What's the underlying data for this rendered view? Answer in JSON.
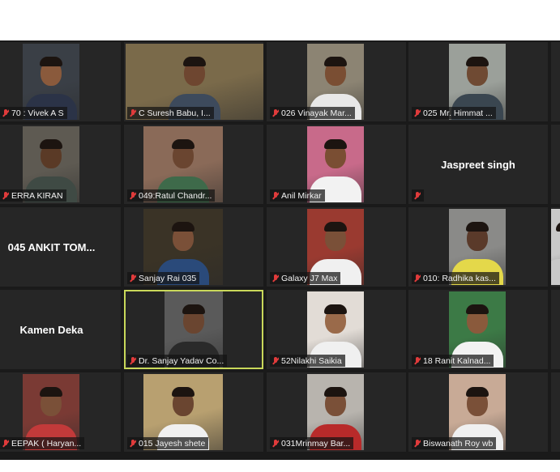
{
  "participants": [
    {
      "label": "70 : Vivek A S",
      "muted": true,
      "video": true,
      "bg": "#3a3f46",
      "skin": "#8a5a3c",
      "shirt": "#2b3347"
    },
    {
      "label": "C Suresh Babu, I...",
      "muted": true,
      "video": true,
      "bg": "#7a6a4a",
      "skin": "#6e4630",
      "shirt": "#3d4a5c"
    },
    {
      "label": "026 Vinayak Mar...",
      "muted": true,
      "video": true,
      "bg": "#8c8473",
      "skin": "#7a4e33",
      "shirt": "#e8e8e8"
    },
    {
      "label": "025 Mr. Himmat ...",
      "muted": true,
      "video": true,
      "bg": "#9ba09a",
      "skin": "#6f4a33",
      "shirt": "#3a4650"
    },
    {
      "label": "",
      "muted": true,
      "video": false,
      "name": ""
    },
    {
      "label": "ERRA KIRAN",
      "muted": true,
      "video": true,
      "bg": "#5e5a52",
      "skin": "#5a3a26",
      "shirt": "#3f4a44"
    },
    {
      "label": "049:Ratul Chandr...",
      "muted": true,
      "video": true,
      "bg": "#8a6a58",
      "skin": "#6a4530",
      "shirt": "#3e6a4a"
    },
    {
      "label": "Anil Mirkar",
      "muted": true,
      "video": true,
      "bg": "#c86a8a",
      "skin": "#7a4e33",
      "shirt": "#f2f2f2"
    },
    {
      "label": "",
      "muted": true,
      "video": false,
      "name": "Jaspreet singh"
    },
    {
      "label": "",
      "muted": true,
      "video": false,
      "name": ""
    },
    {
      "label": "",
      "muted": false,
      "video": false,
      "name": "045 ANKIT TOM..."
    },
    {
      "label": "Sanjay Rai 035",
      "muted": true,
      "video": true,
      "bg": "#3a3326",
      "skin": "#7a5038",
      "shirt": "#2a4a7a"
    },
    {
      "label": "Galaxy J7 Max",
      "muted": true,
      "video": true,
      "bg": "#9a3a30",
      "skin": "#7a5038",
      "shirt": "#f0f0f0"
    },
    {
      "label": "010: Radhika kas...",
      "muted": true,
      "video": true,
      "bg": "#8a8a88",
      "skin": "#5a3a2a",
      "shirt": "#e4d84a"
    },
    {
      "label": "",
      "muted": false,
      "video": true,
      "bg": "#c8c8c8",
      "skin": "#c8c8c8",
      "shirt": "#c8c8c8"
    },
    {
      "label": "",
      "muted": false,
      "video": false,
      "name": "Kamen Deka"
    },
    {
      "label": "Dr. Sanjay Yadav Co...",
      "muted": true,
      "video": true,
      "bg": "#5a5a5a",
      "skin": "#6a4530",
      "shirt": "#2a2a2a",
      "active": true
    },
    {
      "label": "52Nilakhi Saikia",
      "muted": true,
      "video": true,
      "bg": "#e2dcd6",
      "skin": "#9a6a4a",
      "shirt": "#f0f0f0"
    },
    {
      "label": "18 Ranit Kalnad...",
      "muted": true,
      "video": true,
      "bg": "#3c7a46",
      "skin": "#8a5a3c",
      "shirt": "#f2f2f2"
    },
    {
      "label": "",
      "muted": true,
      "video": false,
      "name": ""
    },
    {
      "label": "EEPAK ( Haryan...",
      "muted": true,
      "video": true,
      "bg": "#7a3a34",
      "skin": "#7a5038",
      "shirt": "#c23a3a"
    },
    {
      "label": "015 Jayesh shete",
      "muted": true,
      "video": true,
      "bg": "#b8a070",
      "skin": "#6a4530",
      "shirt": "#f0f0f0"
    },
    {
      "label": "031Mrinmay Bar...",
      "muted": true,
      "video": true,
      "bg": "#b8b4ae",
      "skin": "#7a5038",
      "shirt": "#b82a2a"
    },
    {
      "label": "Biswanath Roy wb",
      "muted": true,
      "video": true,
      "bg": "#c8aa96",
      "skin": "#7a5038",
      "shirt": "#f0f0f0"
    },
    {
      "label": "",
      "muted": true,
      "video": false,
      "name": ""
    }
  ]
}
